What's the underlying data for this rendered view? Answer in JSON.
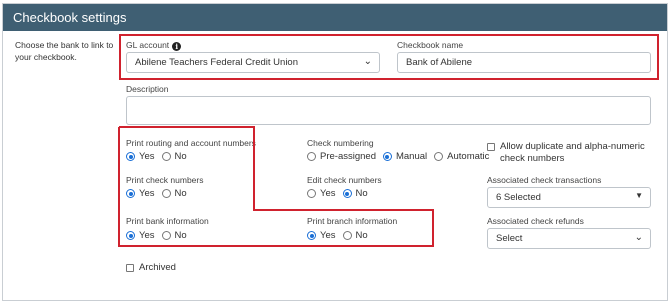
{
  "panel": {
    "title": "Checkbook settings"
  },
  "help_text": "Choose the bank to link to your checkbook.",
  "gl_account": {
    "label": "GL account",
    "value": "Abilene Teachers Federal Credit Union"
  },
  "checkbook_name": {
    "label": "Checkbook name",
    "value": "Bank of Abilene"
  },
  "description": {
    "label": "Description",
    "value": ""
  },
  "print_routing": {
    "label": "Print routing and account numbers",
    "options": [
      "Yes",
      "No"
    ],
    "selected": "Yes"
  },
  "print_check_numbers": {
    "label": "Print check numbers",
    "options": [
      "Yes",
      "No"
    ],
    "selected": "Yes"
  },
  "print_bank_info": {
    "label": "Print bank information",
    "options": [
      "Yes",
      "No"
    ],
    "selected": "Yes"
  },
  "check_numbering": {
    "label": "Check numbering",
    "options": [
      "Pre-assigned",
      "Manual",
      "Automatic"
    ],
    "selected": "Manual"
  },
  "edit_check_numbers": {
    "label": "Edit check numbers",
    "options": [
      "Yes",
      "No"
    ],
    "selected": "No"
  },
  "print_branch_info": {
    "label": "Print branch information",
    "options": [
      "Yes",
      "No"
    ],
    "selected": "Yes"
  },
  "allow_duplicate": {
    "label": "Allow duplicate and alpha-numeric check numbers",
    "checked": false
  },
  "associated_transactions": {
    "label": "Associated check transactions",
    "value": "6 Selected"
  },
  "associated_refunds": {
    "label": "Associated check refunds",
    "value": "Select"
  },
  "archived": {
    "label": "Archived",
    "checked": false
  },
  "icons": {
    "info": "info-icon",
    "chevron": "chevron-down-icon",
    "caret": "caret-down-icon"
  },
  "colors": {
    "header": "#3f5f73",
    "highlight": "#d0222e",
    "radio_selected": "#1a6fd6"
  }
}
